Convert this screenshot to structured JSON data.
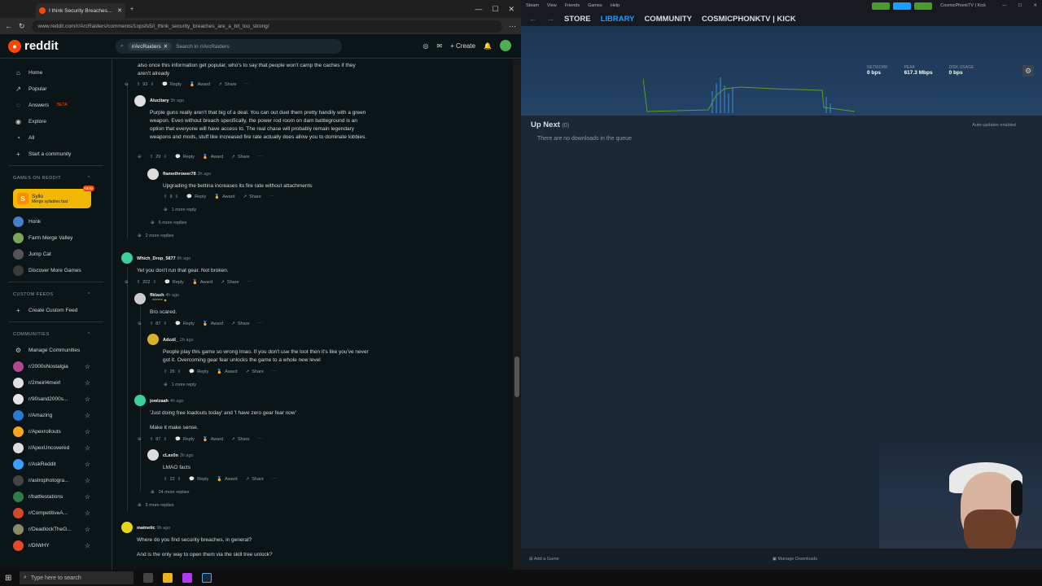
{
  "browser": {
    "tab_title": "I think Security Breaches are a bit",
    "url": "www.reddit.com/r/ArcRaiders/comments/1opsfs5/i_think_security_breaches_are_a_bit_too_strong/"
  },
  "header": {
    "logo": "reddit",
    "search_chip": "r/ArcRaiders",
    "search_placeholder": "Search in r/ArcRaiders",
    "create_label": "Create"
  },
  "sidebar": {
    "items": [
      {
        "label": "Home",
        "icon": "home-icon"
      },
      {
        "label": "Popular",
        "icon": "popular-icon"
      },
      {
        "label": "Answers",
        "icon": "answers-icon",
        "badge": "BETA"
      },
      {
        "label": "Explore",
        "icon": "explore-icon"
      },
      {
        "label": "All",
        "icon": "all-icon"
      },
      {
        "label": "Start a community",
        "icon": "plus-icon"
      }
    ],
    "games_heading": "GAMES ON REDDIT",
    "syllo": {
      "title": "Syllo",
      "subtitle": "Merge syllables fast",
      "badge": "NEW"
    },
    "games": [
      "Honk",
      "Farm Merge Valley",
      "Jump Cat",
      "Discover More Games"
    ],
    "custom_feeds_heading": "CUSTOM FEEDS",
    "create_feed": "Create Custom Feed",
    "communities_heading": "COMMUNITIES",
    "manage": "Manage Communities",
    "communities": [
      {
        "name": "r/2000sNostalgia",
        "color": "#b04a8c"
      },
      {
        "name": "r/2meirl4meirl",
        "color": "#e0e0e0"
      },
      {
        "name": "r/90sand2000s...",
        "color": "#e6e6e6"
      },
      {
        "name": "r/Amazing",
        "color": "#2a7bd4"
      },
      {
        "name": "r/Apexrollouts",
        "color": "#f5a623"
      },
      {
        "name": "r/ApexUncovered",
        "color": "#dddddd"
      },
      {
        "name": "r/AskReddit",
        "color": "#3aa0ff"
      },
      {
        "name": "r/astrophotogra...",
        "color": "#444"
      },
      {
        "name": "r/battlestations",
        "color": "#2f7d4a"
      },
      {
        "name": "r/CompetitiveA...",
        "color": "#d14b2a"
      },
      {
        "name": "r/DeadlockTheG...",
        "color": "#8a8a6a"
      },
      {
        "name": "r/DIWHY",
        "color": "#e04b2a"
      }
    ]
  },
  "comments": [
    {
      "id": "c0",
      "user": "",
      "time": "",
      "text": "also once this information get popular, who's to say that people won't camp the caches if they aren't already",
      "votes": "93"
    },
    {
      "id": "c1",
      "user": "Alucitary",
      "time": "3h ago",
      "text": "Purple guns really aren't that big of a deal. You can out duel them pretty handily with a green weapon. Even without breach specifically, the power rod room on dam battleground is an option that everyone will have access to. The real chase will probably remain legendary weapons and mods, stuff like increased fire rate actually does allow you to dominate lobbies.",
      "votes": "29"
    },
    {
      "id": "c2",
      "user": "flamethrower78",
      "time": "3h ago",
      "text": "Upgrading the bettina increases its fire rate without attachments",
      "votes": "8",
      "more": "1 more reply"
    },
    {
      "id": "c3",
      "user": "Which_Drop_5877",
      "time": "8h ago",
      "text": "Yet you don't run that gear. Not broken.",
      "votes": "202"
    },
    {
      "id": "c4",
      "user": "flklash",
      "time": "4h ago",
      "text": "Bro scared.",
      "votes": "87",
      "flair": "****** ♥"
    },
    {
      "id": "c5",
      "user": "Adzzil_",
      "time": "2h ago",
      "text": "People play this game so wrong lmao. If you don't use the loot then it's like you've never got it. Overcoming gear fear unlocks the game to a whole new level",
      "votes": "26",
      "more": "1 more reply"
    },
    {
      "id": "c6",
      "user": "jowlzaah",
      "time": "4h ago",
      "text": "'Just doing free loadouts today' and 'I have zero gear fear now'",
      "text2": "Make it make sense.",
      "votes": "87"
    },
    {
      "id": "c7",
      "user": "cLax0n",
      "time": "3h ago",
      "text": "LMAO facts",
      "votes": "22",
      "more": "24 more replies"
    },
    {
      "id": "c8",
      "user": "matnetic",
      "time": "9h ago",
      "text": "Where do you find security breaches, in general?",
      "text2": "And is the only way to open them via the skill tree unlock?"
    }
  ],
  "more_replies": {
    "r6": "6 more replies",
    "r2": "2 more replies",
    "r5": "5 more replies"
  },
  "actions": {
    "reply": "Reply",
    "award": "Award",
    "share": "Share"
  },
  "steam": {
    "menu": [
      "Steam",
      "View",
      "Friends",
      "Games",
      "Help"
    ],
    "account": "CosmicPhonkTV | Kick",
    "nav": [
      "STORE",
      "LIBRARY",
      "COMMUNITY",
      "COSMICPHONKTV | KICK"
    ],
    "network_label": "NETWORK",
    "network_value": "0 bps",
    "peak_label": "PEAK",
    "peak_value": "617.3 Mbps",
    "disk_label": "DISK USAGE",
    "disk_value": "0 bps",
    "upnext": "Up Next",
    "upnext_count": "(0)",
    "auto_updates": "Auto-updates enabled",
    "empty": "There are no downloads in the queue",
    "add_game": "Add a Game",
    "manage_downloads": "Manage Downloads"
  },
  "taskbar": {
    "search": "Type here to search"
  },
  "colors": {
    "reddit_accent": "#ff4500",
    "steam_accent": "#1a9fff"
  }
}
